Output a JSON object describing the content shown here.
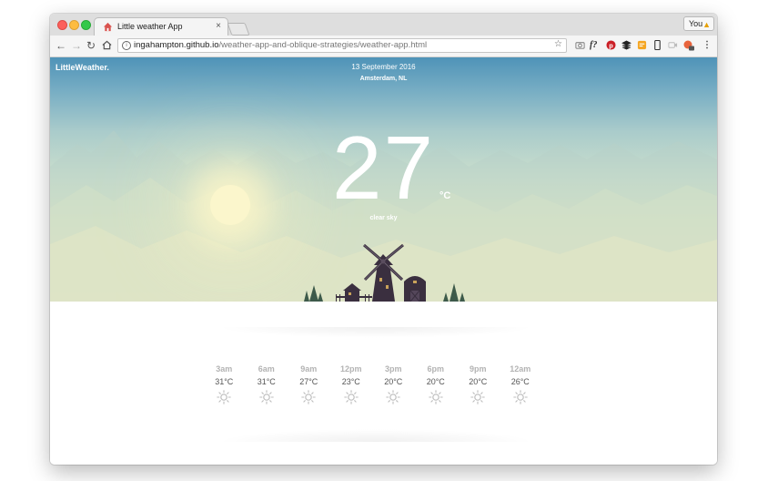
{
  "browser": {
    "tab_title": "Little weather App",
    "tab_close": "×",
    "profile_label": "You",
    "url_host": "ingahampton.github.io",
    "url_path": "/weather-app-and-oblique-strategies/weather-app.html"
  },
  "app": {
    "brand": "LittleWeather.",
    "date": "13 September 2016",
    "location": "Amsterdam, NL",
    "temperature": "27",
    "unit": "°C",
    "condition": "clear sky"
  },
  "forecast": [
    {
      "time": "3am",
      "temp": "31°C",
      "icon": "sun-icon"
    },
    {
      "time": "6am",
      "temp": "31°C",
      "icon": "sun-icon"
    },
    {
      "time": "9am",
      "temp": "27°C",
      "icon": "sun-icon"
    },
    {
      "time": "12pm",
      "temp": "23°C",
      "icon": "sun-icon"
    },
    {
      "time": "3pm",
      "temp": "20°C",
      "icon": "sun-icon"
    },
    {
      "time": "6pm",
      "temp": "20°C",
      "icon": "sun-icon"
    },
    {
      "time": "9pm",
      "temp": "20°C",
      "icon": "sun-icon"
    },
    {
      "time": "12am",
      "temp": "26°C",
      "icon": "sun-icon"
    }
  ],
  "colors": {
    "sky_top": "#4f93b8",
    "sky_bottom": "#f7ebc6",
    "silhouette": "#3a2f3f",
    "tree": "#3d5a4a",
    "forecast_time": "#b3b3b3",
    "forecast_temp": "#555555"
  }
}
